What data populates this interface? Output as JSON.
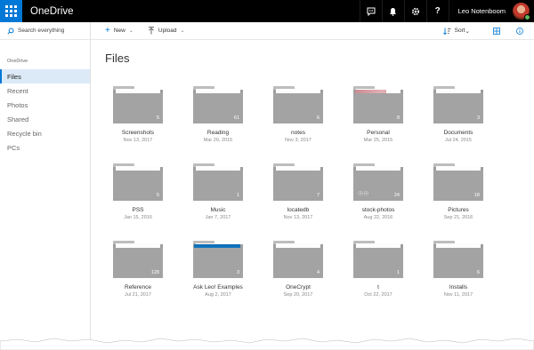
{
  "app": {
    "title": "OneDrive",
    "accent": "#0078d7"
  },
  "user": {
    "name": "Leo Notenboom"
  },
  "top_icons": [
    "chat-icon",
    "bell-icon",
    "gear-icon",
    "help-icon"
  ],
  "top_help": "?",
  "sidebar": {
    "search_placeholder": "Search everything",
    "section": "OneDrive",
    "items": [
      {
        "label": "Files",
        "active": true
      },
      {
        "label": "Recent"
      },
      {
        "label": "Photos"
      },
      {
        "label": "Shared"
      },
      {
        "label": "Recycle bin"
      },
      {
        "label": "PCs"
      }
    ]
  },
  "commands": {
    "new": "New",
    "upload": "Upload",
    "sort": "Sort"
  },
  "main": {
    "title": "Files"
  },
  "files": [
    {
      "name": "Screenshots",
      "date": "Nov 13, 2017",
      "count": "5"
    },
    {
      "name": "Reading",
      "date": "Mar 20, 2015",
      "count": "61"
    },
    {
      "name": "notes",
      "date": "Nov 3, 2017",
      "count": "6"
    },
    {
      "name": "Personal",
      "date": "Mar 25, 2015",
      "count": "8"
    },
    {
      "name": "Documents",
      "date": "Jul 24, 2015",
      "count": "3"
    },
    {
      "name": "PSS",
      "date": "Jan 15, 2016",
      "count": "5"
    },
    {
      "name": "Music",
      "date": "Jan 7, 2017",
      "count": "1"
    },
    {
      "name": "locatedb",
      "date": "Nov 13, 2017",
      "count": "7"
    },
    {
      "name": "stock-photos",
      "date": "Aug 22, 2016",
      "count": "24"
    },
    {
      "name": "Pictures",
      "date": "Sep 21, 2016",
      "count": "18"
    },
    {
      "name": "Reference",
      "date": "Jul 21, 2017",
      "count": "128"
    },
    {
      "name": "Ask Leo! Examples",
      "date": "Aug 2, 2017",
      "count": "3"
    },
    {
      "name": "OneCrypt",
      "date": "Sep 20, 2017",
      "count": "4"
    },
    {
      "name": "t",
      "date": "Oct 22, 2017",
      "count": "1"
    },
    {
      "name": "Installs",
      "date": "Nov 11, 2017",
      "count": "6"
    }
  ]
}
